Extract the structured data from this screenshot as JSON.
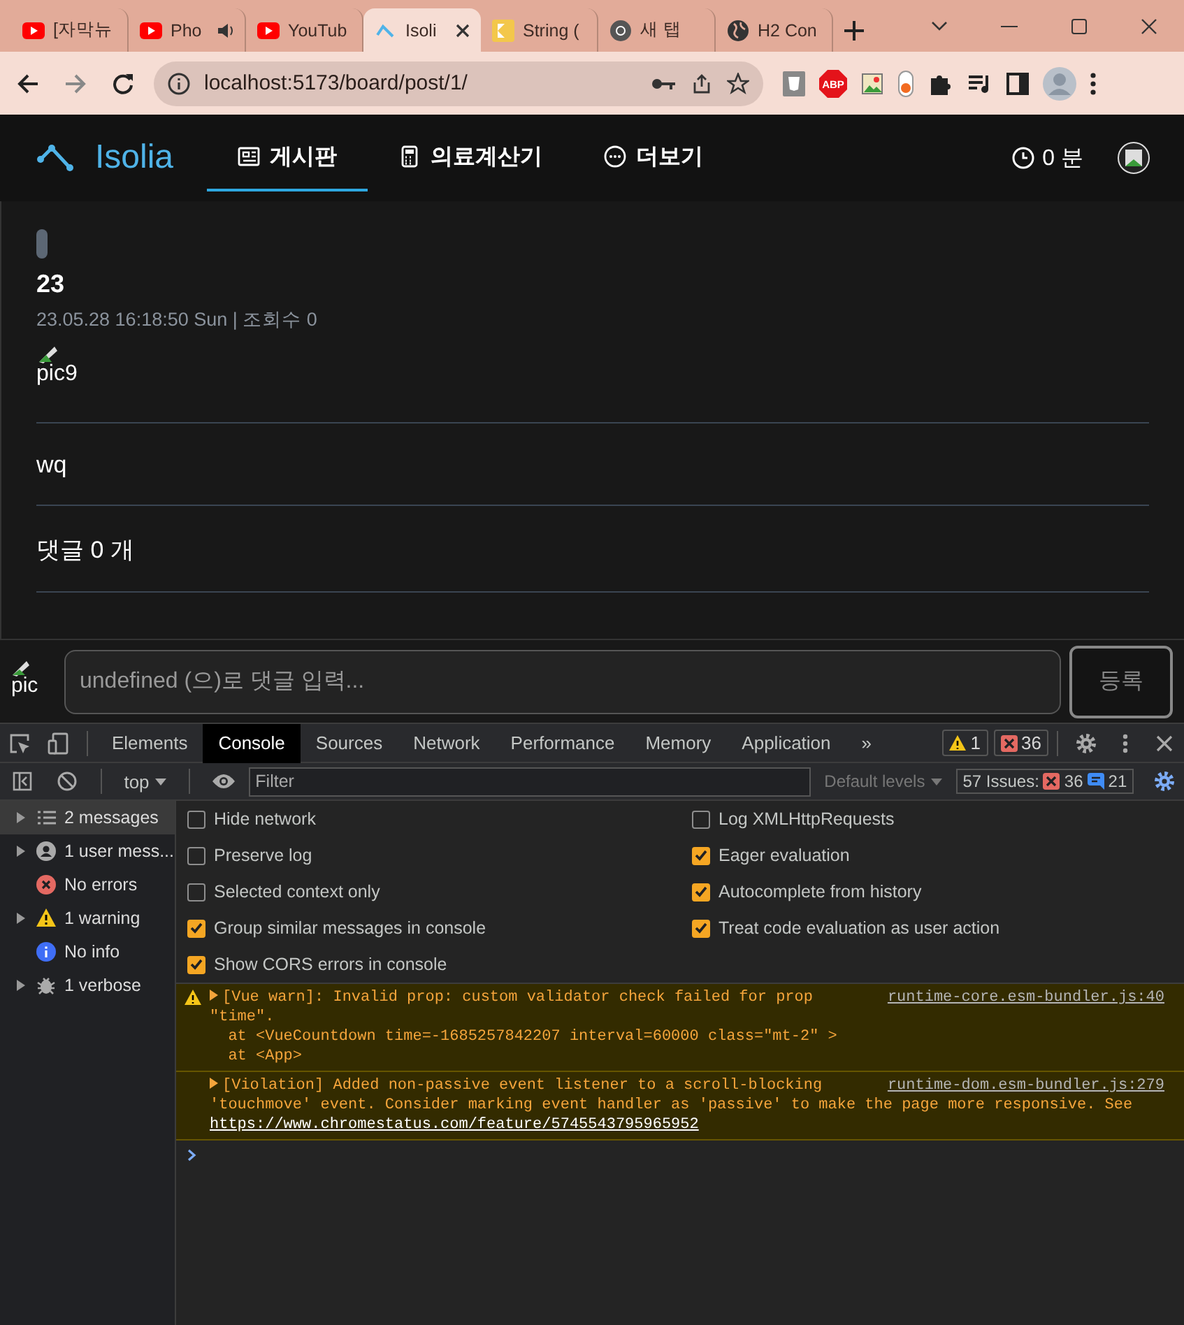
{
  "browser": {
    "tabs": [
      {
        "kind": "youtube",
        "title": "[자막뉴",
        "selected": false,
        "audio": false
      },
      {
        "kind": "youtube",
        "title": "Pho",
        "selected": false,
        "audio": true
      },
      {
        "kind": "youtube",
        "title": "YouTub",
        "selected": false,
        "audio": false
      },
      {
        "kind": "isolia",
        "title": "Isoli",
        "selected": true,
        "audio": false
      },
      {
        "kind": "kotlin",
        "title": "String (",
        "selected": false,
        "audio": false
      },
      {
        "kind": "chrome",
        "title": "새 탭",
        "selected": false,
        "audio": false
      },
      {
        "kind": "globe",
        "title": "H2 Con",
        "selected": false,
        "audio": false
      }
    ],
    "address": "localhost:5173/board/post/1/",
    "adblock_label": "ABP"
  },
  "app": {
    "logo": "Isolia",
    "nav": [
      {
        "kind": "board",
        "label": "게시판",
        "selected": true
      },
      {
        "kind": "calculator",
        "label": "의료계산기",
        "selected": false
      },
      {
        "kind": "more",
        "label": "더보기",
        "selected": false
      }
    ],
    "timer": "0 분"
  },
  "post": {
    "title": "23",
    "meta": "23.05.28 16:18:50 Sun | 조회수 0",
    "image_alt": "pic9",
    "body": "wq",
    "comments_heading": "댓글 0 개"
  },
  "comment_box": {
    "avatar_alt": "pic",
    "placeholder": "undefined (으)로 댓글 입력...",
    "submit": "등록"
  },
  "devtools": {
    "tabs": [
      {
        "label": "Elements",
        "selected": false
      },
      {
        "label": "Console",
        "selected": true
      },
      {
        "label": "Sources",
        "selected": false
      },
      {
        "label": "Network",
        "selected": false
      },
      {
        "label": "Performance",
        "selected": false
      },
      {
        "label": "Memory",
        "selected": false
      },
      {
        "label": "Application",
        "selected": false
      }
    ],
    "more": "»",
    "warning_count": "1",
    "error_count": "36",
    "context": "top",
    "filter_placeholder": "Filter",
    "levels": "Default levels",
    "issues": {
      "label": "57 Issues:",
      "errors": "36",
      "info": "21"
    },
    "sidebar": [
      {
        "kind": "messages",
        "label": "2 messages",
        "expandable": true,
        "selected": true
      },
      {
        "kind": "user",
        "label": "1 user mess...",
        "expandable": true,
        "selected": false
      },
      {
        "kind": "error",
        "label": "No errors",
        "expandable": false,
        "selected": false
      },
      {
        "kind": "warning",
        "label": "1 warning",
        "expandable": true,
        "selected": false
      },
      {
        "kind": "info",
        "label": "No info",
        "expandable": false,
        "selected": false
      },
      {
        "kind": "verbose",
        "label": "1 verbose",
        "expandable": true,
        "selected": false
      }
    ],
    "settings": [
      {
        "label": "Hide network",
        "checked": false
      },
      {
        "label": "Preserve log",
        "checked": false
      },
      {
        "label": "Selected context only",
        "checked": false
      },
      {
        "label": "Group similar messages in console",
        "checked": true
      },
      {
        "label": "Show CORS errors in console",
        "checked": true
      },
      {
        "label": "Log XMLHttpRequests",
        "checked": false
      },
      {
        "label": "Eager evaluation",
        "checked": true
      },
      {
        "label": "Autocomplete from history",
        "checked": true
      },
      {
        "label": "Treat code evaluation as user action",
        "checked": true
      }
    ],
    "messages": [
      {
        "kind": "warning",
        "lines": [
          "[Vue warn]: Invalid prop: custom validator check failed for prop",
          "\"time\".",
          "  at <VueCountdown time=-1685257842207 interval=60000 class=\"mt-2\" >",
          "  at <App>"
        ],
        "source": "runtime-core.esm-bundler.js:40"
      },
      {
        "kind": "violation",
        "lines": [
          "[Violation] Added non-passive event listener to a scroll-blocking",
          "'touchmove' event. Consider marking event handler as 'passive' to make the page more responsive. See"
        ],
        "link": "https://www.chromestatus.com/feature/5745543795965952",
        "source": "runtime-dom.esm-bundler.js:279"
      }
    ]
  }
}
